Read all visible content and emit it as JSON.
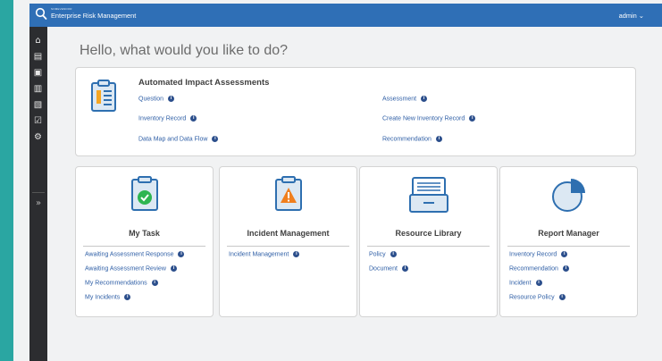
{
  "header": {
    "brand_small": "SOMEVENDOR",
    "app_title": "Enterprise Risk Management",
    "user_label": "admin ⌄"
  },
  "sidebar": {
    "icons": [
      "home-icon",
      "document-icon",
      "profile-icon",
      "printer-icon",
      "search-document-icon",
      "checkbox-icon",
      "gear-icon"
    ],
    "expand_label": "»"
  },
  "main": {
    "greeting": "Hello, what would you like to do?",
    "automated_impact_assessments": {
      "title": "Automated Impact Assessments",
      "links_left": [
        "Question",
        "Inventory Record",
        "Data Map and Data Flow"
      ],
      "links_right": [
        "Assessment",
        "Create New Inventory Record",
        "Recommendation"
      ]
    },
    "cards": [
      {
        "title": "My Task",
        "icon": "clipboard-check-icon",
        "links": [
          "Awaiting Assessment Response",
          "Awaiting Assessment Review",
          "My Recommendations",
          "My Incidents"
        ]
      },
      {
        "title": "Incident Management",
        "icon": "clipboard-warning-icon",
        "links": [
          "Incident Management"
        ]
      },
      {
        "title": "Resource Library",
        "icon": "file-box-icon",
        "links": [
          "Policy",
          "Document"
        ]
      },
      {
        "title": "Report Manager",
        "icon": "pie-chart-icon",
        "links": [
          "Inventory Record",
          "Recommendation",
          "Incident",
          "Resource Policy"
        ]
      }
    ],
    "info_glyph": "i"
  },
  "colors": {
    "topbar": "#2f6fb6",
    "sidebar": "#2c2d30",
    "teal_edge": "#2aa6a2",
    "link": "#2f5fa6",
    "green_check": "#2eb551",
    "warning_orange": "#f07f1e",
    "icon_blue": "#2e6fb0"
  }
}
